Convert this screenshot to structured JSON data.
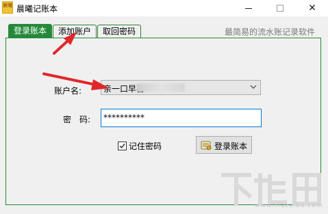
{
  "window": {
    "title": "晨曦记账本",
    "icon_text": "晨曦",
    "close_glyph": "✕"
  },
  "tabs": [
    {
      "label": "登录账本",
      "active": true
    },
    {
      "label": "添加账户",
      "active": false
    },
    {
      "label": "取回密码",
      "active": false
    }
  ],
  "slogan": "最简易的流水账记录软件",
  "form": {
    "account_label": "账户名:",
    "account_value": "亲一口早喜",
    "password_label": "密　码:",
    "password_value": "**********",
    "remember_label": "记住密码",
    "remember_checked": true,
    "login_label": "登录账本"
  },
  "watermark": {
    "text": "下载吧",
    "url": "www.xiazaiba.com"
  },
  "colors": {
    "accent_green": "#24893a",
    "annotation_red": "#e0282a",
    "focus_blue": "#0078d7"
  },
  "icons": {
    "app": "ledger-app-icon",
    "dropdown": "chevron-down-icon",
    "checkbox": "checkmark-icon",
    "login": "login-key-icon"
  }
}
